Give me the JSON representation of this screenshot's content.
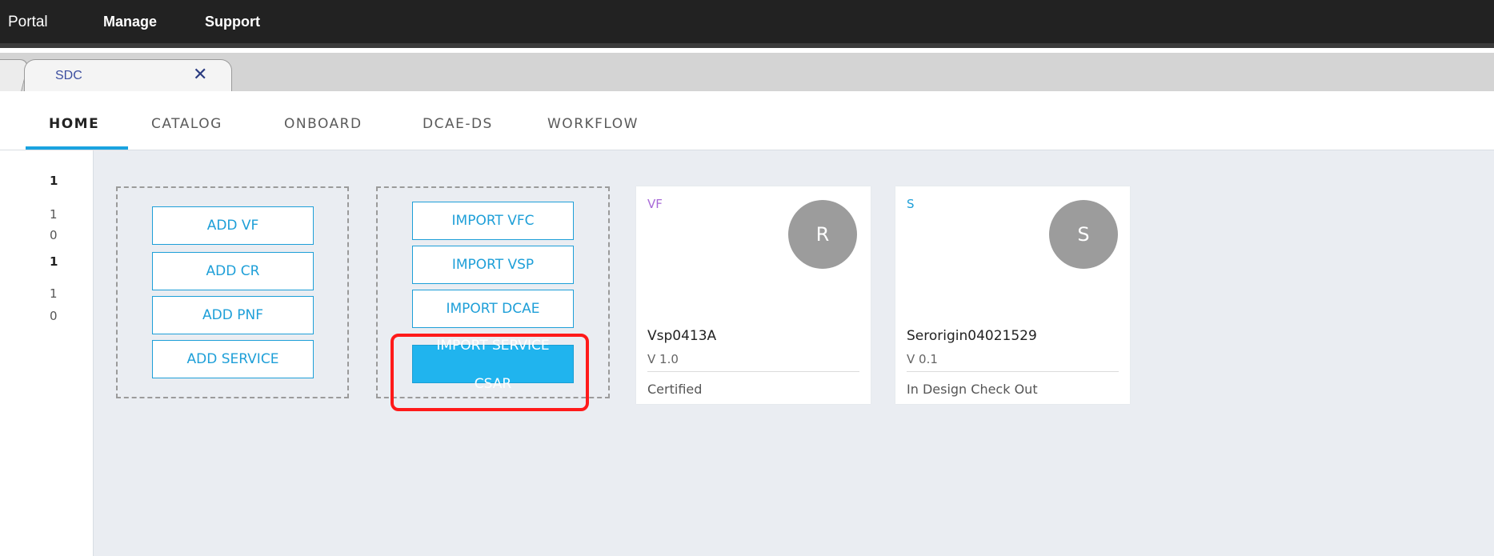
{
  "portal_menu": {
    "items": [
      "Portal",
      "Manage",
      "Support"
    ]
  },
  "tabs": {
    "active_label": "SDC",
    "close_glyph": "✕"
  },
  "nav": {
    "items": [
      "HOME",
      "CATALOG",
      "ONBOARD",
      "DCAE-DS",
      "WORKFLOW"
    ],
    "active": "HOME",
    "accent": "#1aa3e0"
  },
  "sidebar": {
    "numbers": [
      "1",
      "1",
      "0",
      "1",
      "1",
      "0"
    ]
  },
  "add_buttons": [
    "ADD VF",
    "ADD CR",
    "ADD PNF",
    "ADD SERVICE"
  ],
  "import_buttons": {
    "vfc": "IMPORT VFC",
    "vsp": "IMPORT VSP",
    "dcae": "IMPORT DCAE",
    "service_csar_line1": "IMPORT SERVICE",
    "service_csar_line2": "CSAR"
  },
  "cards": [
    {
      "type": "VF",
      "type_color": "#a86ad8",
      "avatar_letter": "R",
      "name": "Vsp0413A",
      "version": "V 1.0",
      "status": "Certified"
    },
    {
      "type": "S",
      "type_color": "#1e9fd8",
      "avatar_letter": "S",
      "name": "Serorigin04021529",
      "version": "V 0.1",
      "status": "In Design Check Out"
    }
  ]
}
